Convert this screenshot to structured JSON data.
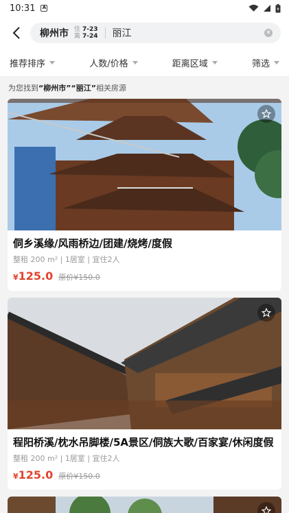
{
  "status": {
    "time": "10:31"
  },
  "search": {
    "city": "柳州市",
    "checkin_label": "住",
    "checkin": "7-23",
    "checkout_label": "离",
    "checkout": "7-24",
    "query": "丽江"
  },
  "filters": [
    "推荐排序",
    "人数/价格",
    "距离区域",
    "筛选"
  ],
  "result_note": {
    "prefix": "为您找到",
    "city": "“柳州市”",
    "query": "“丽江”",
    "suffix": "相关房源"
  },
  "listings": [
    {
      "title": "侗乡溪缘/风雨桥边/团建/烧烤/度假",
      "meta": "整租 200 m² | 1居室 | 宜住2人",
      "currency": "¥",
      "price": "125.0",
      "original_price": "原价¥150.0"
    },
    {
      "title": "程阳桥溪/枕水吊脚楼/5A景区/侗族大歌/百家宴/休闲度假",
      "meta": "整租 200 m² | 1居室 | 宜住2人",
      "currency": "¥",
      "price": "125.0",
      "original_price": "原价¥150.0"
    }
  ],
  "icons": {
    "back": "back-arrow-icon",
    "clear": "clear-icon",
    "fav": "star-icon"
  },
  "colors": {
    "price": "#e0442f",
    "sky": "#9fc6e6"
  }
}
